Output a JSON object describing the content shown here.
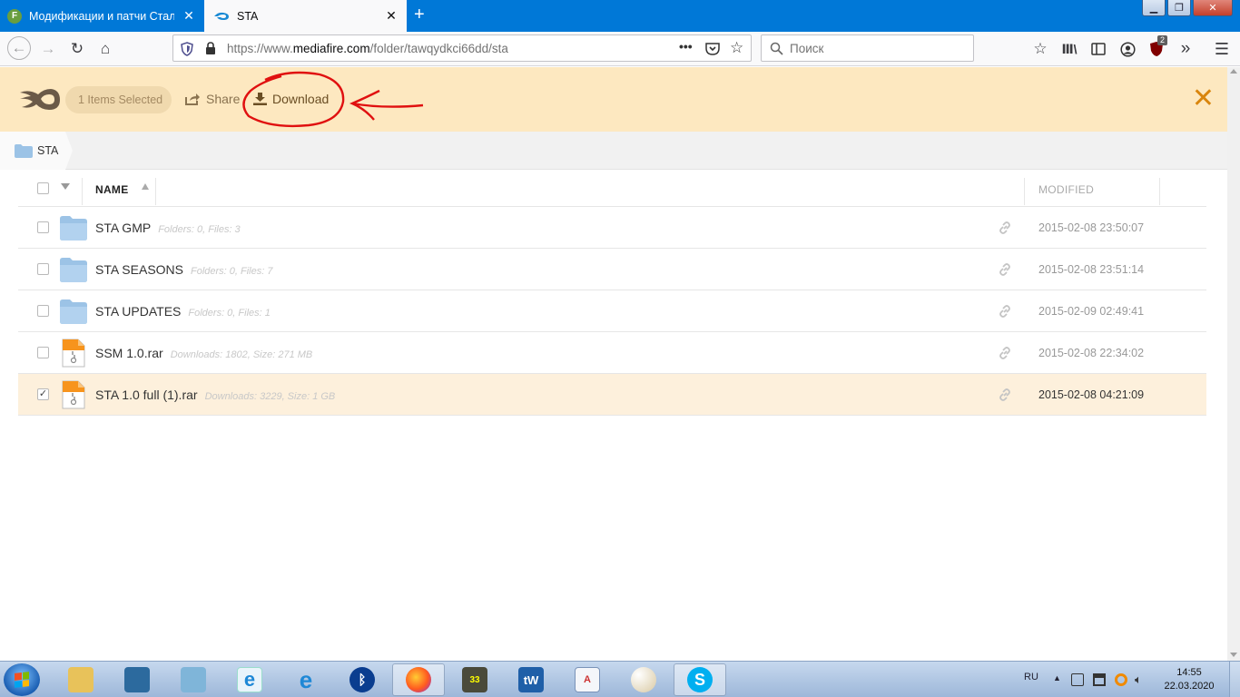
{
  "browser": {
    "tabs": [
      {
        "label": "Модификации и патчи Стальных",
        "active": false
      },
      {
        "label": "STA",
        "active": true
      }
    ],
    "url_prefix": "https://www.",
    "url_domain": "mediafire.com",
    "url_path": "/folder/tawqydkci66dd/sta",
    "search_placeholder": "Поиск",
    "badge_count": "2"
  },
  "selection_bar": {
    "count_label": "1 Items Selected",
    "share_label": "Share",
    "download_label": "Download"
  },
  "breadcrumb": {
    "folder": "STA"
  },
  "table": {
    "col_name": "NAME",
    "col_modified": "MODIFIED",
    "rows": [
      {
        "name": "STA GMP",
        "meta": "Folders: 0, Files: 3",
        "modified": "2015-02-08 23:50:07",
        "kind": "folder",
        "checked": false
      },
      {
        "name": "STA SEASONS",
        "meta": "Folders: 0, Files: 7",
        "modified": "2015-02-08 23:51:14",
        "kind": "folder",
        "checked": false
      },
      {
        "name": "STA UPDATES",
        "meta": "Folders: 0, Files: 1",
        "modified": "2015-02-09 02:49:41",
        "kind": "folder",
        "checked": false
      },
      {
        "name": "SSM 1.0.rar",
        "meta": "Downloads: 1802, Size: 271 MB",
        "modified": "2015-02-08 22:34:02",
        "kind": "archive",
        "checked": false
      },
      {
        "name": "STA 1.0 full (1).rar",
        "meta": "Downloads: 3229, Size: 1 GB",
        "modified": "2015-02-08 04:21:09",
        "kind": "archive",
        "checked": true
      }
    ]
  },
  "taskbar": {
    "language": "RU",
    "time": "14:55",
    "date": "22.03.2020",
    "apps": [
      "explorer",
      "toolbox",
      "network-users",
      "internet-explorer",
      "internet-explorer-alt",
      "bluetooth",
      "firefox",
      "game",
      "tw",
      "text-editor",
      "paint",
      "skype"
    ]
  },
  "colors": {
    "accent_orange": "#d9850d",
    "selection_bg": "#fde8c0",
    "titlebar_blue": "#0078d7"
  }
}
